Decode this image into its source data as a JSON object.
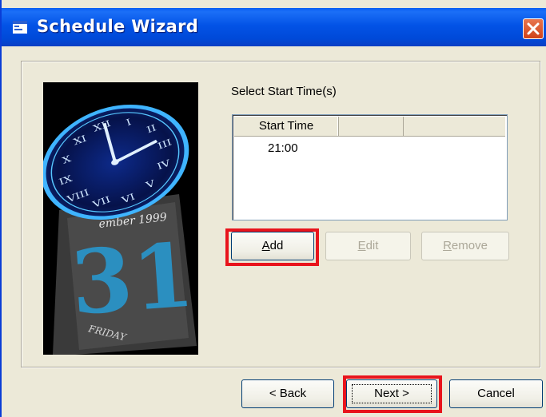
{
  "window": {
    "title": "Schedule Wizard",
    "icon": "window-app-icon",
    "close_icon": "close-icon"
  },
  "image": {
    "description_icon": "calendar-clock-image",
    "calendar_text": "ember 1999",
    "day_number": "31",
    "weekday": "FRIDAY"
  },
  "start_times": {
    "label": "Select Start Time(s)",
    "columns": [
      "Start Time",
      ""
    ],
    "rows": [
      {
        "start_time": "21:00"
      }
    ]
  },
  "buttons": {
    "add": {
      "label_prefix": "",
      "mnemonic": "A",
      "label_rest": "dd",
      "enabled": true
    },
    "edit": {
      "label_prefix": "",
      "mnemonic": "E",
      "label_rest": "dit",
      "enabled": false
    },
    "remove": {
      "label_prefix": "",
      "mnemonic": "R",
      "label_rest": "emove",
      "enabled": false
    }
  },
  "nav": {
    "back": "< Back",
    "next": "Next >",
    "cancel": "Cancel"
  },
  "colors": {
    "titlebar": "#0353e6",
    "highlight": "#e8141c",
    "dialog_bg": "#ece9d8"
  }
}
